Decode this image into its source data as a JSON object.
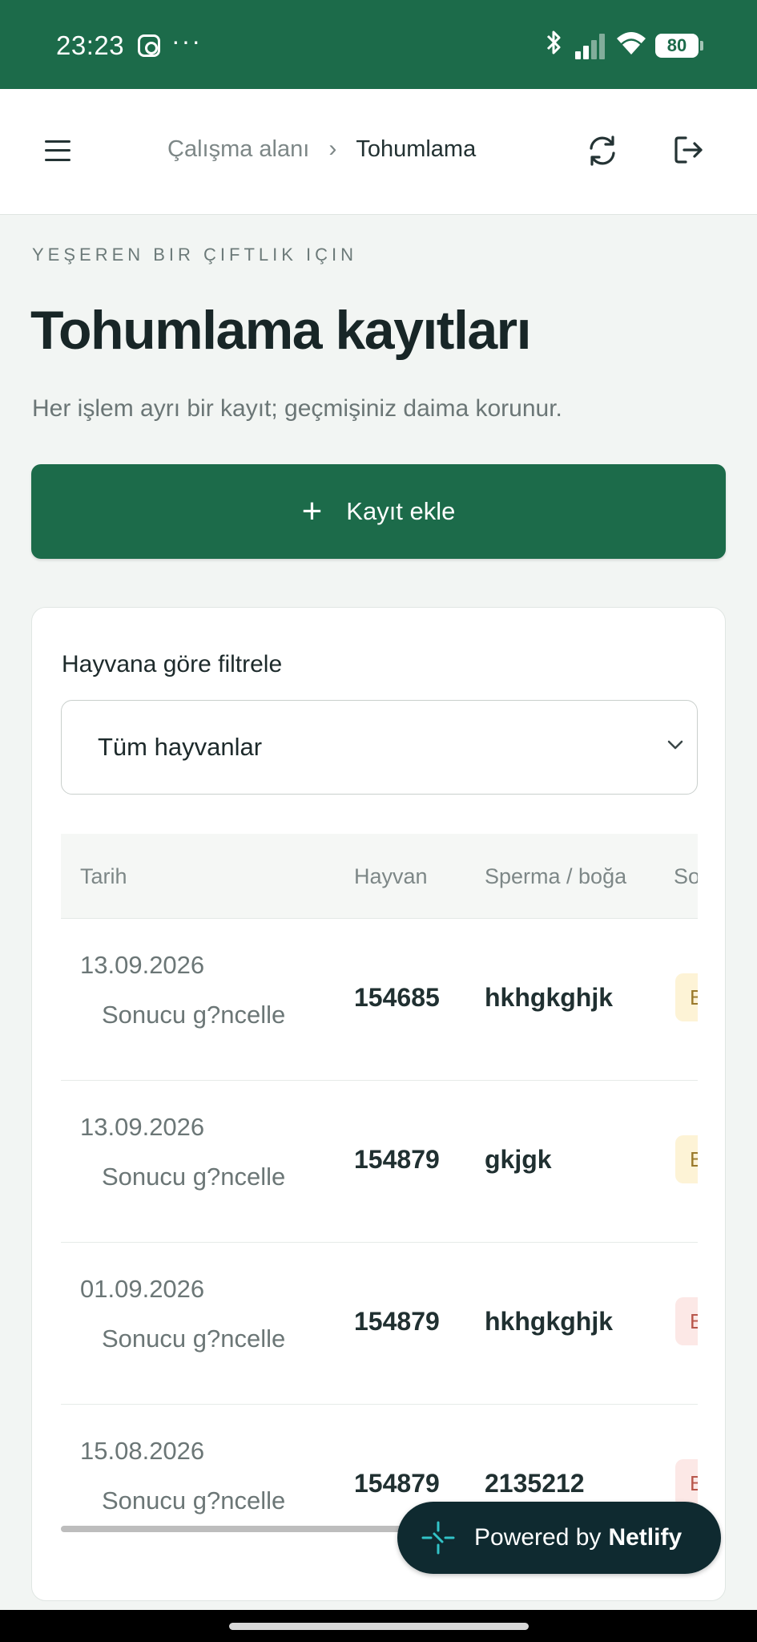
{
  "status_bar": {
    "time": "23:23",
    "icons": [
      "instagram-icon",
      "more-dots-icon",
      "bluetooth-icon",
      "signal-icon",
      "wifi-icon"
    ],
    "dots": "···",
    "battery": "80"
  },
  "app_bar": {
    "breadcrumb_parent": "Çalışma alanı",
    "breadcrumb_separator": "›",
    "breadcrumb_current": "Tohumlama",
    "icons": [
      "menu-icon",
      "refresh-icon",
      "logout-icon"
    ]
  },
  "page": {
    "eyebrow": "YEŞEREN BIR ÇIFTLIK IÇIN",
    "title": "Tohumlama kayıtları",
    "subtitle": "Her işlem ayrı bir kayıt; geçmişiniz daima korunur."
  },
  "add_button": {
    "plus": "+",
    "label": "Kayıt ekle"
  },
  "filter": {
    "label": "Hayvana göre filtrele",
    "selected": "Tüm hayvanlar"
  },
  "table": {
    "columns": [
      "Tarih",
      "Hayvan",
      "Sperma / boğa",
      "So"
    ],
    "rows": [
      {
        "date": "13.09.2026",
        "action": "Sonucu g?ncelle",
        "animal": "154685",
        "semen": "hkhgkghjk",
        "badge": "B"
      },
      {
        "date": "13.09.2026",
        "action": "Sonucu g?ncelle",
        "animal": "154879",
        "semen": "gkjgk",
        "badge": "B"
      },
      {
        "date": "01.09.2026",
        "action": "Sonucu g?ncelle",
        "animal": "154879",
        "semen": "hkhgkghjk",
        "badge": "B"
      },
      {
        "date": "15.08.2026",
        "action": "Sonucu g?ncelle",
        "animal": "154879",
        "semen": "2135212",
        "badge": "B"
      }
    ]
  },
  "badge_colors": {
    "pending_bg": "#fdf3d6",
    "pending_fg": "#9a7a2c",
    "negative_bg": "#fce8e6",
    "negative_fg": "#b8574c"
  },
  "netlify": {
    "prefix": "Powered by",
    "brand": "Netlify"
  },
  "colors": {
    "brand": "#1c6b4a",
    "netlify_bg": "#0f2a30",
    "netlify_accent": "#32c3c7"
  }
}
